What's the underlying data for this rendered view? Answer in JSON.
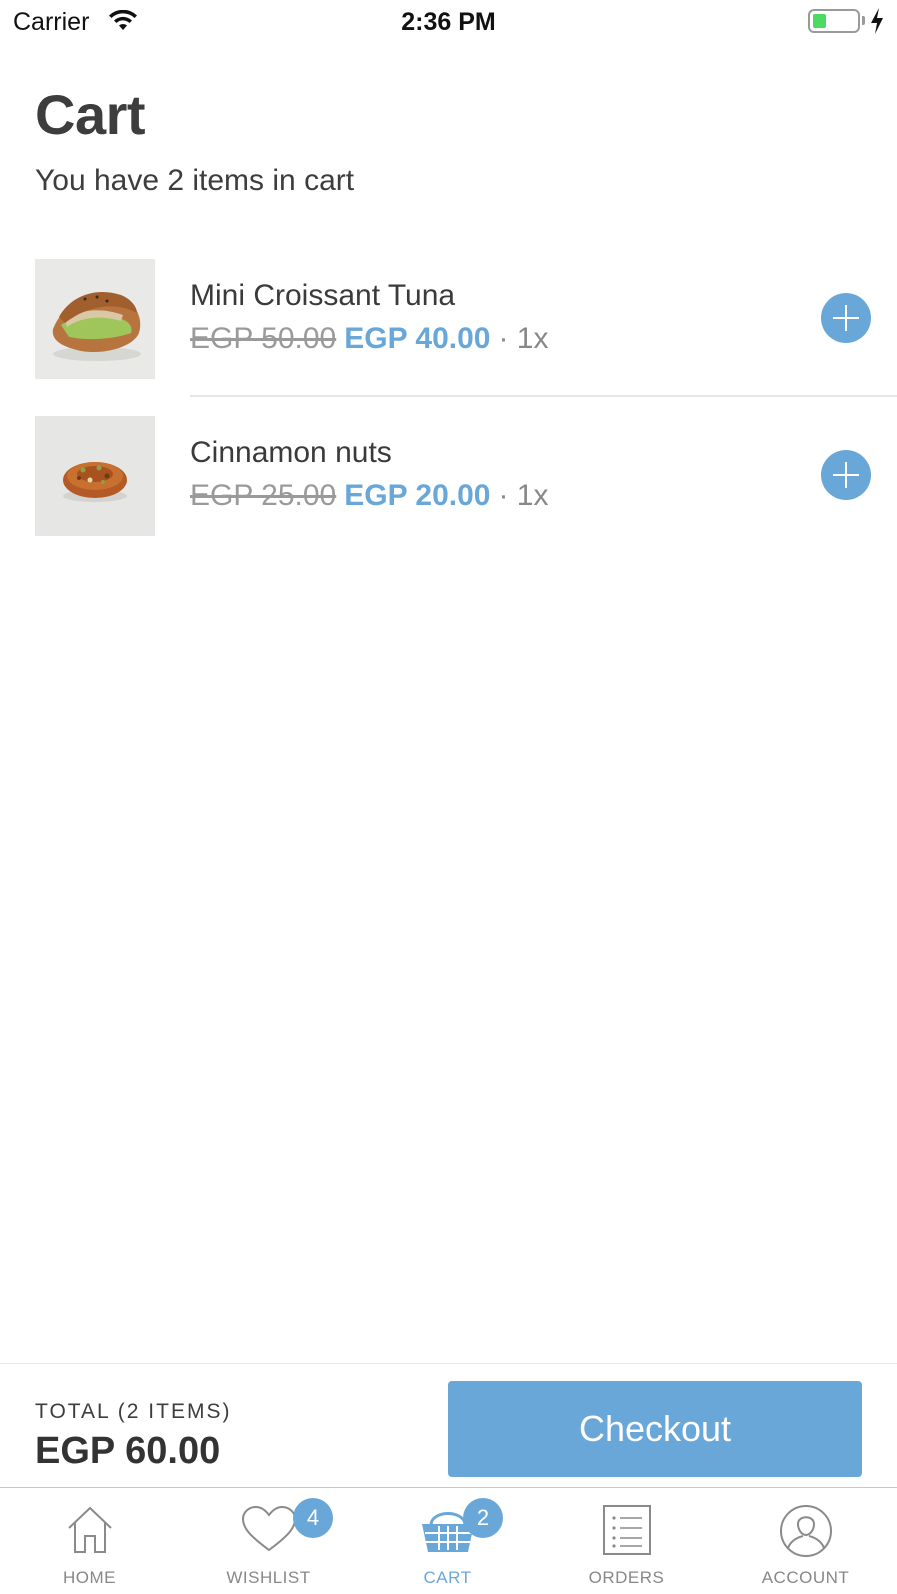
{
  "status_bar": {
    "carrier": "Carrier",
    "time": "2:36 PM",
    "battery_level": 0.3
  },
  "header": {
    "title": "Cart",
    "subtitle": "You have 2 items in cart"
  },
  "cart": {
    "items": [
      {
        "name": "Mini Croissant Tuna",
        "old_price": "EGP 50.00",
        "new_price": "EGP 40.00",
        "quantity": "· 1x",
        "image_icon": "croissant-photo"
      },
      {
        "name": "Cinnamon nuts",
        "old_price": "EGP 25.00",
        "new_price": "EGP 20.00",
        "quantity": "· 1x",
        "image_icon": "cinnamon-pastry-photo"
      }
    ]
  },
  "summary": {
    "total_label": "TOTAL (2 ITEMS)",
    "total_value": "EGP 60.00",
    "checkout_label": "Checkout"
  },
  "tab_bar": {
    "tabs": [
      {
        "label": "HOME",
        "icon": "home-icon"
      },
      {
        "label": "WISHLIST",
        "icon": "heart-icon",
        "badge": "4"
      },
      {
        "label": "CART",
        "icon": "basket-icon",
        "badge": "2",
        "active": true
      },
      {
        "label": "ORDERS",
        "icon": "list-icon"
      },
      {
        "label": "ACCOUNT",
        "icon": "user-icon"
      }
    ]
  },
  "colors": {
    "accent": "#6aa7d9",
    "text": "#3d3d3d",
    "muted": "#9a9a9a"
  }
}
